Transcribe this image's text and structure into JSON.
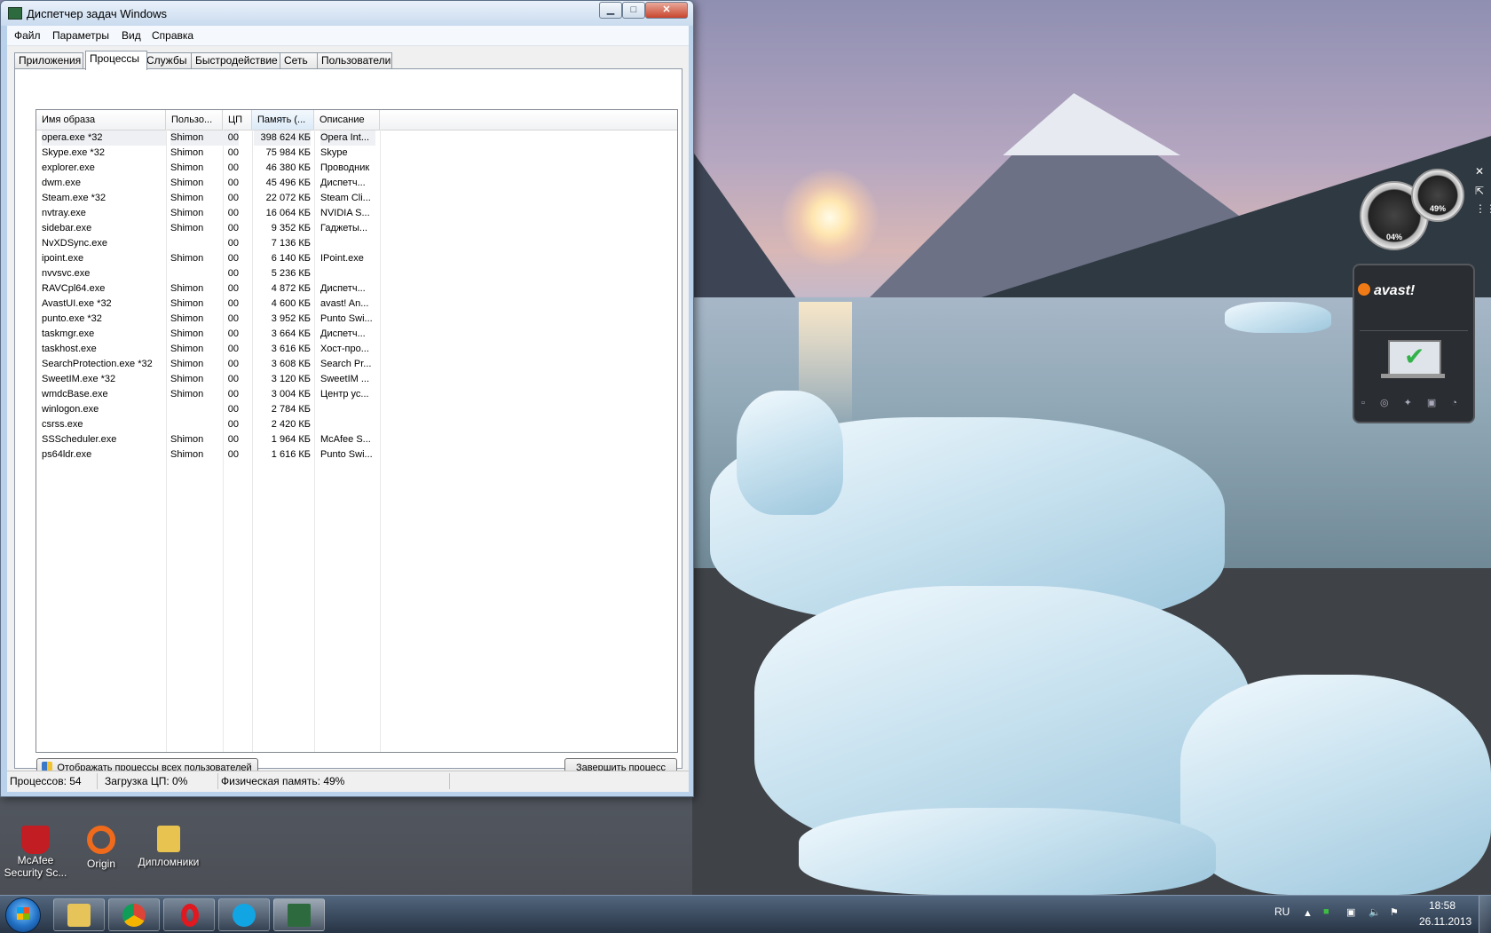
{
  "window": {
    "title": "Диспетчер задач Windows",
    "buttons": {
      "minimize": "▁",
      "maximize": "□",
      "close": "✕"
    }
  },
  "menu": [
    "Файл",
    "Параметры",
    "Вид",
    "Справка"
  ],
  "tabs": [
    "Приложения",
    "Процессы",
    "Службы",
    "Быстродействие",
    "Сеть",
    "Пользователи"
  ],
  "active_tab": "Процессы",
  "columns": [
    "Имя образа",
    "Пользо...",
    "ЦП",
    "Память (...",
    "Описание"
  ],
  "sorted_column": "Память (...",
  "processes": [
    {
      "name": "opera.exe *32",
      "user": "Shimon",
      "cpu": "00",
      "memory": "398 624 КБ",
      "description": "Opera Int..."
    },
    {
      "name": "Skype.exe *32",
      "user": "Shimon",
      "cpu": "00",
      "memory": "75 984 КБ",
      "description": "Skype"
    },
    {
      "name": "explorer.exe",
      "user": "Shimon",
      "cpu": "00",
      "memory": "46 380 КБ",
      "description": "Проводник"
    },
    {
      "name": "dwm.exe",
      "user": "Shimon",
      "cpu": "00",
      "memory": "45 496 КБ",
      "description": "Диспетч..."
    },
    {
      "name": "Steam.exe *32",
      "user": "Shimon",
      "cpu": "00",
      "memory": "22 072 КБ",
      "description": "Steam Cli..."
    },
    {
      "name": "nvtray.exe",
      "user": "Shimon",
      "cpu": "00",
      "memory": "16 064 КБ",
      "description": "NVIDIA S..."
    },
    {
      "name": "sidebar.exe",
      "user": "Shimon",
      "cpu": "00",
      "memory": "9 352 КБ",
      "description": "Гаджеты..."
    },
    {
      "name": "NvXDSync.exe",
      "user": "",
      "cpu": "00",
      "memory": "7 136 КБ",
      "description": ""
    },
    {
      "name": "ipoint.exe",
      "user": "Shimon",
      "cpu": "00",
      "memory": "6 140 КБ",
      "description": "IPoint.exe"
    },
    {
      "name": "nvvsvc.exe",
      "user": "",
      "cpu": "00",
      "memory": "5 236 КБ",
      "description": ""
    },
    {
      "name": "RAVCpl64.exe",
      "user": "Shimon",
      "cpu": "00",
      "memory": "4 872 КБ",
      "description": "Диспетч..."
    },
    {
      "name": "AvastUI.exe *32",
      "user": "Shimon",
      "cpu": "00",
      "memory": "4 600 КБ",
      "description": "avast! An..."
    },
    {
      "name": "punto.exe *32",
      "user": "Shimon",
      "cpu": "00",
      "memory": "3 952 КБ",
      "description": "Punto Swi..."
    },
    {
      "name": "taskmgr.exe",
      "user": "Shimon",
      "cpu": "00",
      "memory": "3 664 КБ",
      "description": "Диспетч..."
    },
    {
      "name": "taskhost.exe",
      "user": "Shimon",
      "cpu": "00",
      "memory": "3 616 КБ",
      "description": "Хост-про..."
    },
    {
      "name": "SearchProtection.exe *32",
      "user": "Shimon",
      "cpu": "00",
      "memory": "3 608 КБ",
      "description": "Search Pr..."
    },
    {
      "name": "SweetIM.exe *32",
      "user": "Shimon",
      "cpu": "00",
      "memory": "3 120 КБ",
      "description": "SweetIM ..."
    },
    {
      "name": "wmdcBase.exe",
      "user": "Shimon",
      "cpu": "00",
      "memory": "3 004 КБ",
      "description": "Центр ус..."
    },
    {
      "name": "winlogon.exe",
      "user": "",
      "cpu": "00",
      "memory": "2 784 КБ",
      "description": ""
    },
    {
      "name": "csrss.exe",
      "user": "",
      "cpu": "00",
      "memory": "2 420 КБ",
      "description": ""
    },
    {
      "name": "SSScheduler.exe",
      "user": "Shimon",
      "cpu": "00",
      "memory": "1 964 КБ",
      "description": "McAfee S..."
    },
    {
      "name": "ps64ldr.exe",
      "user": "Shimon",
      "cpu": "00",
      "memory": "1 616 КБ",
      "description": "Punto Swi..."
    }
  ],
  "buttons": {
    "show_all": "Отображать процессы всех пользователей",
    "end_process": "Завершить процесс"
  },
  "status": {
    "processes": "Процессов: 54",
    "cpu": "Загрузка ЦП: 0%",
    "memory": "Физическая память: 49%"
  },
  "desktop_icons": [
    {
      "label": "McAfee Security Sc...",
      "icon": "mcafee-icon"
    },
    {
      "label": "Origin",
      "icon": "origin-icon"
    },
    {
      "label": "Дипломники",
      "icon": "folder-icon"
    }
  ],
  "gadgets": {
    "cpu_meter": {
      "cpu": "04%",
      "memory": "49%"
    },
    "avast": {
      "logo": "avast!"
    }
  },
  "taskbar": {
    "pinned": [
      "start-button",
      "explorer-icon",
      "chrome-icon",
      "opera-icon",
      "skype-icon",
      "task-manager-icon"
    ],
    "language": "RU",
    "time": "18:58",
    "date": "26.11.2013"
  },
  "colors": {
    "window_frame": "#b9d1ea",
    "selection": "#eef0f3",
    "taskbar": "#273445",
    "avast_orange": "#f07b16"
  }
}
